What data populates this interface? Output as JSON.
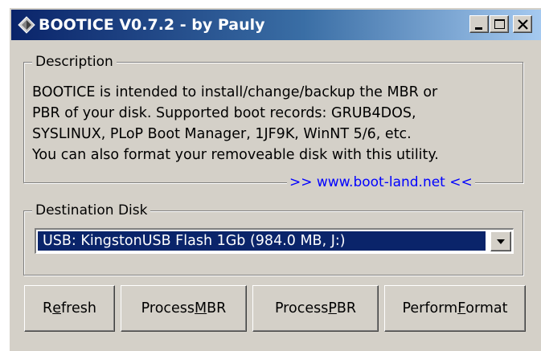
{
  "window": {
    "title": "BOOTICE V0.7.2 - by Pauly",
    "icon": "diamond-app-icon",
    "caption_buttons": [
      "minimize-icon",
      "maximize-icon",
      "close-icon"
    ]
  },
  "description": {
    "legend": "Description",
    "lines": [
      "BOOTICE is intended to install/change/backup the MBR or",
      "PBR of your disk. Supported boot records: GRUB4DOS,",
      "SYSLINUX, PLoP Boot Manager, 1JF9K, WinNT 5/6, etc.",
      "You can also format your removeable disk with this utility."
    ],
    "link": ">> www.boot-land.net <<"
  },
  "destination": {
    "legend": "Destination Disk",
    "selected_disk": "USB: KingstonUSB Flash 1Gb (984.0 MB, J:)"
  },
  "buttons": {
    "refresh": {
      "before": "R",
      "accel": "e",
      "after": "fresh"
    },
    "process_mbr": {
      "before": "Process ",
      "accel": "M",
      "after": "BR"
    },
    "process_pbr": {
      "before": "Process ",
      "accel": "P",
      "after": "BR"
    },
    "perform_format": {
      "before": "Perform ",
      "accel": "F",
      "after": "ormat"
    }
  },
  "colors": {
    "titlebar_start": "#0a246a",
    "titlebar_end": "#a6caf0",
    "face": "#d4d0c8",
    "selection": "#0a246a",
    "link": "#0000ff"
  }
}
